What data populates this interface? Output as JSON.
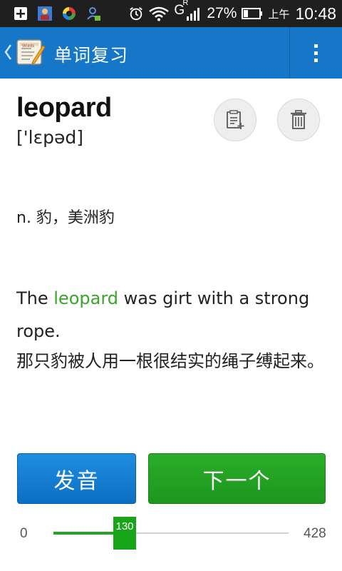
{
  "status_bar": {
    "battery_percent": "27%",
    "ampm": "上午",
    "time": "10:48",
    "network": "G",
    "network_sup": "R"
  },
  "action_bar": {
    "title": "单词复习"
  },
  "word": {
    "text": "leopard",
    "phonetic": "['lɛpəd]",
    "definition": "n. 豹，美洲豹"
  },
  "example": {
    "before": "The ",
    "highlight": "leopard",
    "after": " was girt with a strong rope.",
    "translation": "那只豹被人用一根很结实的绳子缚起来。"
  },
  "buttons": {
    "speak": "发音",
    "next": "下一个"
  },
  "slider": {
    "min": "0",
    "max": "428",
    "value": 130,
    "value_label": "130"
  },
  "colors": {
    "action_bar": "#1677c8",
    "highlight": "#3aa52a",
    "speak_button": "#1677c8",
    "next_button": "#22a122",
    "slider": "#25a525"
  }
}
